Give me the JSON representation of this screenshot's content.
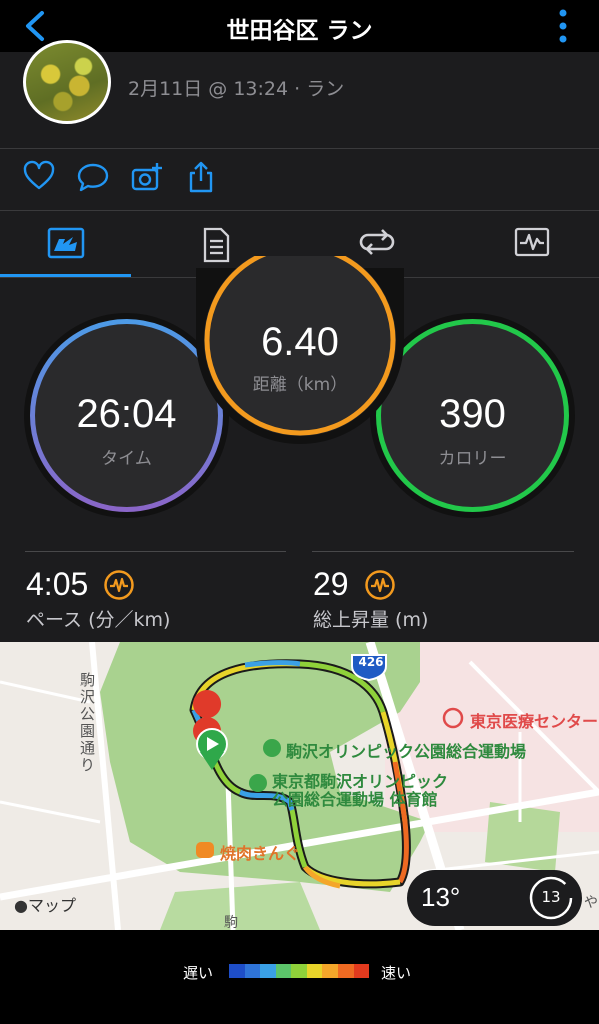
{
  "header": {
    "title": "世田谷区 ラン"
  },
  "activity": {
    "meta": "2月11日 @ 13:24 · ラン"
  },
  "actions": [
    "heart-icon",
    "comment-icon",
    "add-photo-icon",
    "share-icon"
  ],
  "tabs": [
    "overview-icon",
    "details-icon",
    "laps-icon",
    "graph-icon"
  ],
  "stats": {
    "time": {
      "value": "26:04",
      "label": "タイム"
    },
    "distance": {
      "value": "6.40",
      "label": "距離（km）"
    },
    "calories": {
      "value": "390",
      "label": "カロリー"
    },
    "pace": {
      "value": "4:05",
      "label": "ペース (分／km)"
    },
    "ascent": {
      "value": "29",
      "label": "総上昇量 (m)"
    }
  },
  "map": {
    "route_badge": "426",
    "street_label": "駒沢公園通り",
    "hospital": "東京医療センター",
    "poi1": "駒沢オリンピック公園総合運動場",
    "poi2_line1": "東京都駒沢オリンピック",
    "poi2_line2": "公園総合運動場 体育館",
    "restaurant": "焼肉きんぐ",
    "maps_brand": "マップ",
    "komaza": "駒",
    "edge_char": "や",
    "temperature": "13°",
    "weather_badge": "13"
  },
  "legend": {
    "slow": "遅い",
    "fast": "速い",
    "colors": [
      "#1e4ec8",
      "#2f74d8",
      "#3aa0e6",
      "#5cc46a",
      "#8fd13a",
      "#e8d42a",
      "#f4a62a",
      "#ef6a22",
      "#e23a1e"
    ]
  },
  "colors": {
    "accent": "#2196f3",
    "time_ring": "#4a8fe0",
    "distance_ring": "#f39a1e",
    "calorie_ring": "#22c84a"
  }
}
